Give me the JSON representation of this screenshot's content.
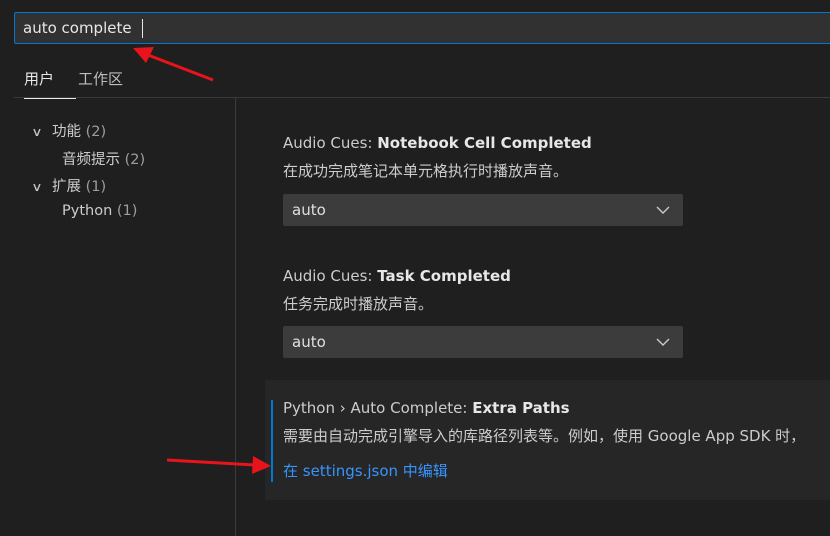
{
  "search": {
    "value": "auto complete"
  },
  "tabs": [
    {
      "label": "用户"
    },
    {
      "label": "工作区"
    }
  ],
  "toc": [
    {
      "label": "功能",
      "count": "(2)"
    },
    {
      "label": "音频提示",
      "count": "(2)"
    },
    {
      "label": "扩展",
      "count": "(1)"
    },
    {
      "label": "Python",
      "count": "(1)"
    }
  ],
  "settings": [
    {
      "category": "Audio Cues: ",
      "name": "Notebook Cell Completed",
      "description": "在成功完成笔记本单元格执行时播放声音。",
      "value": "auto"
    },
    {
      "category": "Audio Cues: ",
      "name": "Task Completed",
      "description": "任务完成时播放声音。",
      "value": "auto"
    },
    {
      "category": "Python › Auto Complete: ",
      "name": "Extra Paths",
      "description": "需要由自动完成引擎导入的库路径列表等。例如，使用 Google App SDK 时，",
      "link": "在 settings.json 中编辑"
    }
  ],
  "colors": {
    "accent": "#0078d4",
    "link": "#3794ff",
    "annotation": "#e8141b"
  }
}
